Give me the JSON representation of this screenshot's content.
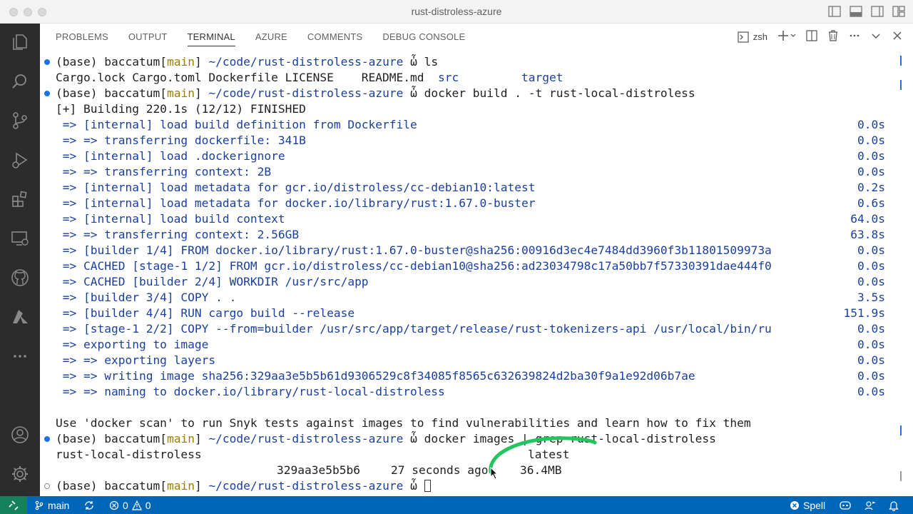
{
  "window": {
    "title": "rust-distroless-azure"
  },
  "panel": {
    "tabs": [
      {
        "label": "PROBLEMS"
      },
      {
        "label": "OUTPUT"
      },
      {
        "label": "TERMINAL"
      },
      {
        "label": "AZURE"
      },
      {
        "label": "COMMENTS"
      },
      {
        "label": "DEBUG CONSOLE"
      }
    ],
    "active_tab": "TERMINAL",
    "shell_label": "zsh"
  },
  "terminal": {
    "prompt": {
      "env": "(base)",
      "user": "baccatum",
      "branch": "main",
      "path": "~/code/rust-distroless-azure",
      "symbol": "ὦ"
    },
    "cmd1": "ls",
    "ls_output": {
      "plain": "Cargo.lock Cargo.toml Dockerfile LICENSE    README.md  ",
      "dir1": "src",
      "dir2": "target"
    },
    "cmd2": "docker build . -t rust-local-distroless",
    "build_header": "[+] Building 220.1s (12/12) FINISHED",
    "steps": [
      {
        "text": " => [internal] load build definition from Dockerfile",
        "time": "0.0s"
      },
      {
        "text": " => => transferring dockerfile: 341B",
        "time": "0.0s"
      },
      {
        "text": " => [internal] load .dockerignore",
        "time": "0.0s"
      },
      {
        "text": " => => transferring context: 2B",
        "time": "0.0s"
      },
      {
        "text": " => [internal] load metadata for gcr.io/distroless/cc-debian10:latest",
        "time": "0.2s"
      },
      {
        "text": " => [internal] load metadata for docker.io/library/rust:1.67.0-buster",
        "time": "0.6s"
      },
      {
        "text": " => [internal] load build context",
        "time": "64.0s"
      },
      {
        "text": " => => transferring context: 2.56GB",
        "time": "63.8s"
      },
      {
        "text": " => [builder 1/4] FROM docker.io/library/rust:1.67.0-buster@sha256:00916d3ec4e7484dd3960f3b11801509973a",
        "time": "0.0s"
      },
      {
        "text": " => CACHED [stage-1 1/2] FROM gcr.io/distroless/cc-debian10@sha256:ad23034798c17a50bb7f57330391dae444f0",
        "time": "0.0s"
      },
      {
        "text": " => CACHED [builder 2/4] WORKDIR /usr/src/app",
        "time": "0.0s"
      },
      {
        "text": " => [builder 3/4] COPY . .",
        "time": "3.5s"
      },
      {
        "text": " => [builder 4/4] RUN cargo build --release",
        "time": "151.9s"
      },
      {
        "text": " => [stage-1 2/2] COPY --from=builder /usr/src/app/target/release/rust-tokenizers-api /usr/local/bin/ru",
        "time": "0.0s"
      },
      {
        "text": " => exporting to image",
        "time": "0.0s"
      },
      {
        "text": " => => exporting layers",
        "time": "0.0s"
      },
      {
        "text": " => => writing image sha256:329aa3e5b5b61d9306529c8f34085f8565c632639824d2ba30f9a1e92d06b7ae",
        "time": "0.0s"
      },
      {
        "text": " => => naming to docker.io/library/rust-local-distroless",
        "time": "0.0s"
      }
    ],
    "scan_hint": "Use 'docker scan' to run Snyk tests against images to find vulnerabilities and learn how to fix them",
    "cmd3": "docker images | grep rust-local-distroless",
    "image_row": {
      "repo": "rust-local-distroless",
      "tag": "latest",
      "id": "329aa3e5b5b6",
      "created": "27 seconds ago",
      "size": "36.4MB"
    }
  },
  "statusbar": {
    "branch": "main",
    "errors": "0",
    "warnings": "0",
    "spell": "Spell"
  },
  "colors": {
    "statusbar": "#0067b8",
    "activitybar": "#2c2c2c",
    "prompt_dot": "#1a73e8",
    "path": "#1a3f9e",
    "branch": "#9a7d00",
    "dir": "#168a3e"
  }
}
